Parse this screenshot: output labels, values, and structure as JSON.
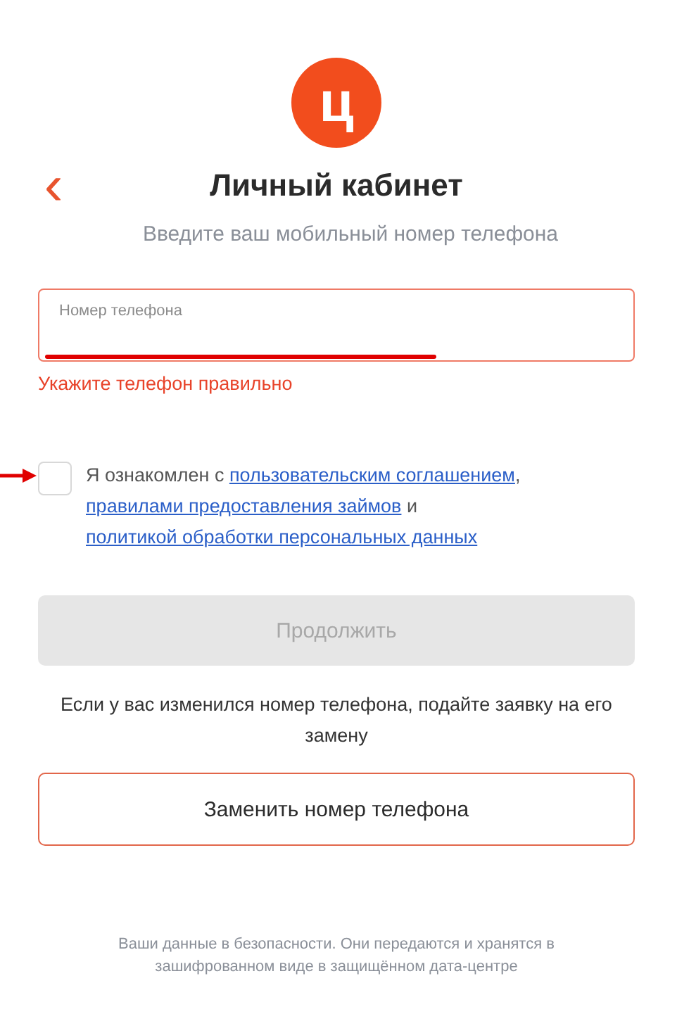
{
  "logo": {
    "letter": "ц"
  },
  "header": {
    "back": "‹",
    "title": "Личный кабинет"
  },
  "subtitle": "Введите ваш мобильный номер телефона",
  "phone_field": {
    "label": "Номер телефона",
    "invalid": true,
    "error": "Укажите телефон правильно"
  },
  "consent": {
    "checked": false,
    "parts": [
      {
        "kind": "text",
        "text": "Я ознакомлен с "
      },
      {
        "kind": "link",
        "text": "пользовательским соглашением"
      },
      {
        "kind": "text",
        "text": ", "
      },
      {
        "kind": "link",
        "text": "правилами предоставления займов"
      },
      {
        "kind": "text",
        "text": " и "
      },
      {
        "kind": "link",
        "text": "политикой обработки персональных данных"
      }
    ]
  },
  "continue_button": {
    "label": "Продолжить",
    "disabled": true
  },
  "change_note": "Если у вас изменился номер телефона, подайте заявку на его замену",
  "replace_button": {
    "label": "Заменить номер телефона"
  },
  "footer": "Ваши данные в безопасности. Они передаются и хранятся в зашифрованном виде в защищённом дата-центре"
}
